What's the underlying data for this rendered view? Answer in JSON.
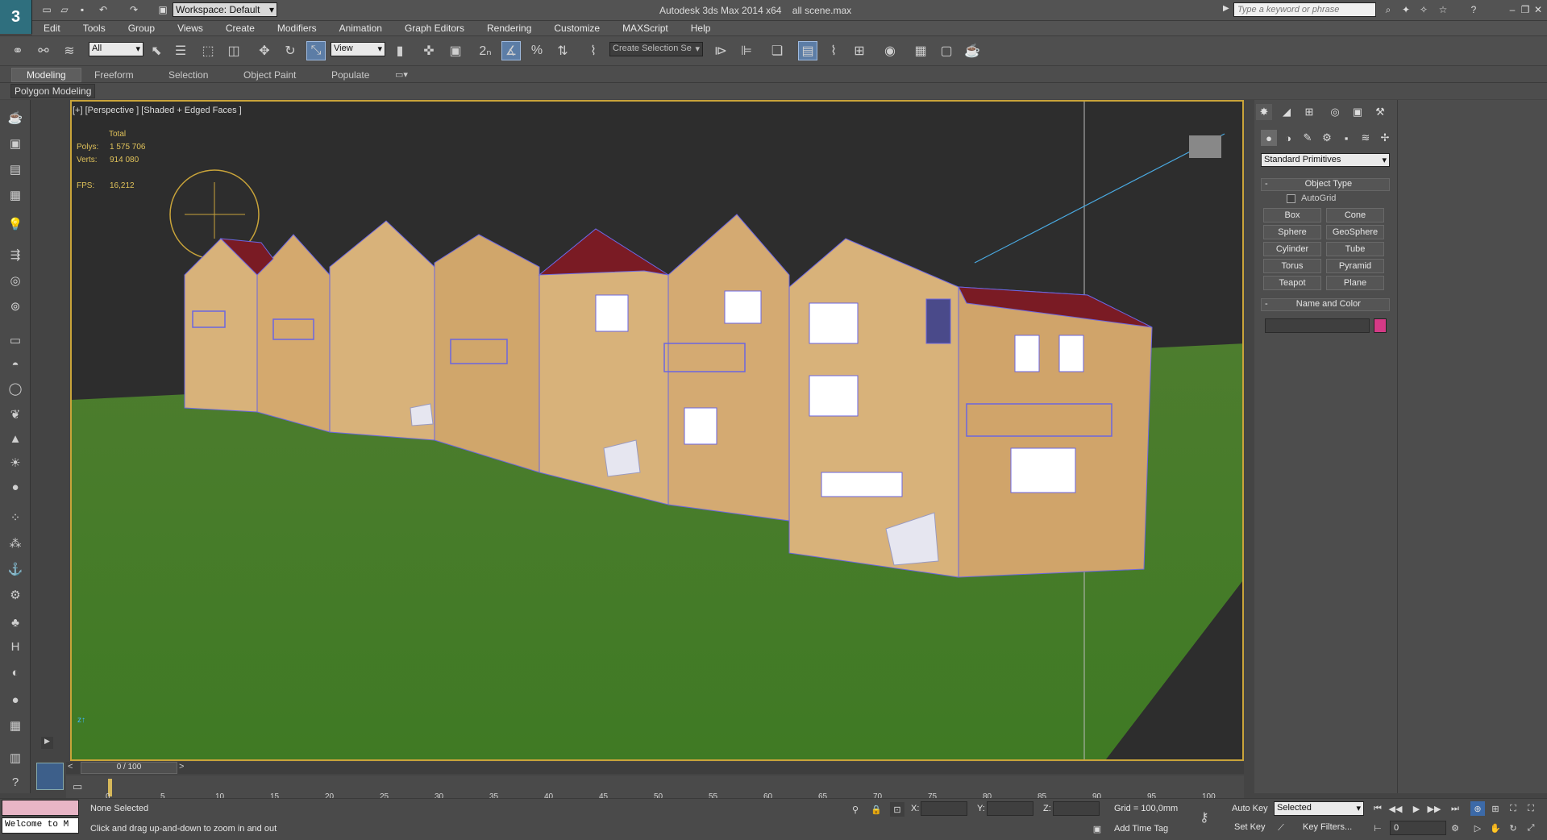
{
  "app": {
    "title": "Autodesk 3ds Max  2014 x64",
    "file": "all scene.max",
    "workspace": "Workspace: Default",
    "search_placeholder": "Type a keyword or phrase"
  },
  "menu": [
    "Edit",
    "Tools",
    "Group",
    "Views",
    "Create",
    "Modifiers",
    "Animation",
    "Graph Editors",
    "Rendering",
    "Customize",
    "MAXScript",
    "Help"
  ],
  "toolbar": {
    "filter_dropdown": "All",
    "ref_coord_dropdown": "View",
    "named_selection": "Create Selection Se"
  },
  "ribbon": {
    "tabs": [
      "Modeling",
      "Freeform",
      "Selection",
      "Object Paint",
      "Populate"
    ],
    "sub": "Polygon Modeling"
  },
  "viewport": {
    "label": "[+] [Perspective ] [Shaded + Edged Faces ]",
    "stats_title": "Total",
    "polys_label": "Polys:",
    "polys_value": "1 575 706",
    "verts_label": "Verts:",
    "verts_value": "914 080",
    "fps_label": "FPS:",
    "fps_value": "16,212"
  },
  "command_panel": {
    "category_dropdown": "Standard Primitives",
    "object_type_title": "Object Type",
    "autogrid_label": "AutoGrid",
    "buttons": [
      "Box",
      "Cone",
      "Sphere",
      "GeoSphere",
      "Cylinder",
      "Tube",
      "Torus",
      "Pyramid",
      "Teapot",
      "Plane"
    ],
    "name_color_title": "Name and Color",
    "object_color": "#d43a86"
  },
  "timeline": {
    "slider_label": "0 / 100",
    "ticks": [
      "0",
      "5",
      "10",
      "15",
      "20",
      "25",
      "30",
      "35",
      "40",
      "45",
      "50",
      "55",
      "60",
      "65",
      "70",
      "75",
      "80",
      "85",
      "90",
      "95",
      "100"
    ]
  },
  "status": {
    "maxscript_text": "Welcome to M",
    "selection": "None Selected",
    "prompt": "Click and drag up-and-down to zoom in and out",
    "x_label": "X:",
    "y_label": "Y:",
    "z_label": "Z:",
    "grid": "Grid = 100,0mm",
    "add_time_tag": "Add Time Tag",
    "auto_key": "Auto Key",
    "set_key": "Set Key",
    "key_mode_dropdown": "Selected",
    "key_filters": "Key Filters...",
    "frame_value": "0"
  }
}
